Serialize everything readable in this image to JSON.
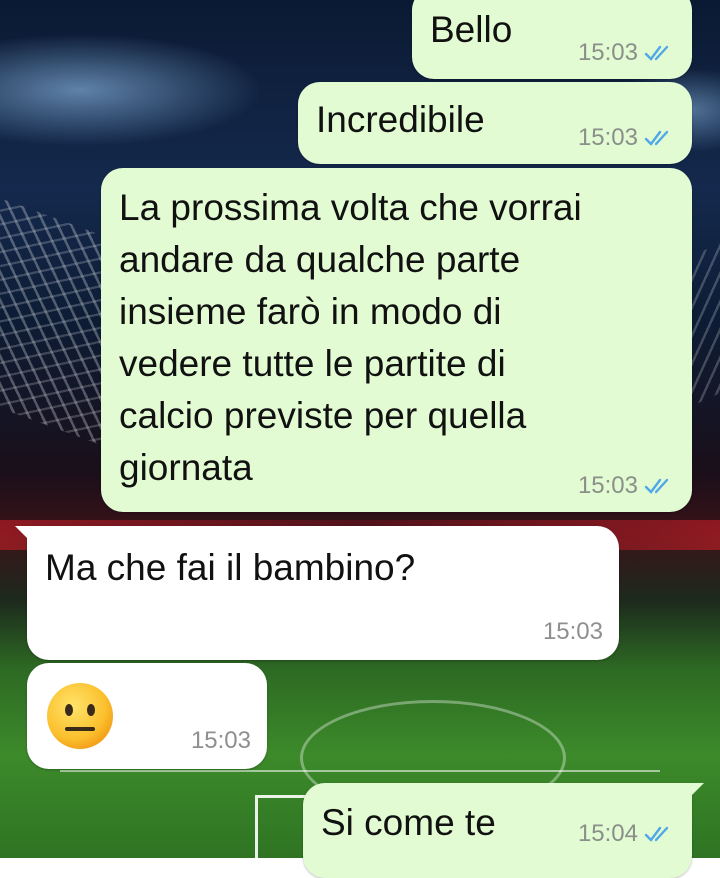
{
  "colors": {
    "outgoing_bubble": "#e2fbd3",
    "incoming_bubble": "#ffffff",
    "read_ticks": "#4fa8e8",
    "timestamp": "#8a9089"
  },
  "messages": [
    {
      "direction": "outgoing",
      "text": "Bello",
      "time": "15:03",
      "status": "read",
      "status_icon": "double-check-icon"
    },
    {
      "direction": "outgoing",
      "text": "Incredibile",
      "time": "15:03",
      "status": "read",
      "status_icon": "double-check-icon"
    },
    {
      "direction": "outgoing",
      "text": "La prossima volta che vorrai\nandare da qualche parte\ninsieme farò in modo di\nvedere tutte le partite di\ncalcio previste per quella\ngiornata",
      "time": "15:03",
      "status": "read",
      "status_icon": "double-check-icon"
    },
    {
      "direction": "incoming",
      "text": "Ma che fai il bambino?",
      "time": "15:03"
    },
    {
      "direction": "incoming",
      "text": "",
      "emoji": "neutral-face-emoji",
      "time": "15:03"
    },
    {
      "direction": "outgoing",
      "text": "Si come te",
      "time": "15:04",
      "status": "read",
      "status_icon": "double-check-icon"
    }
  ]
}
